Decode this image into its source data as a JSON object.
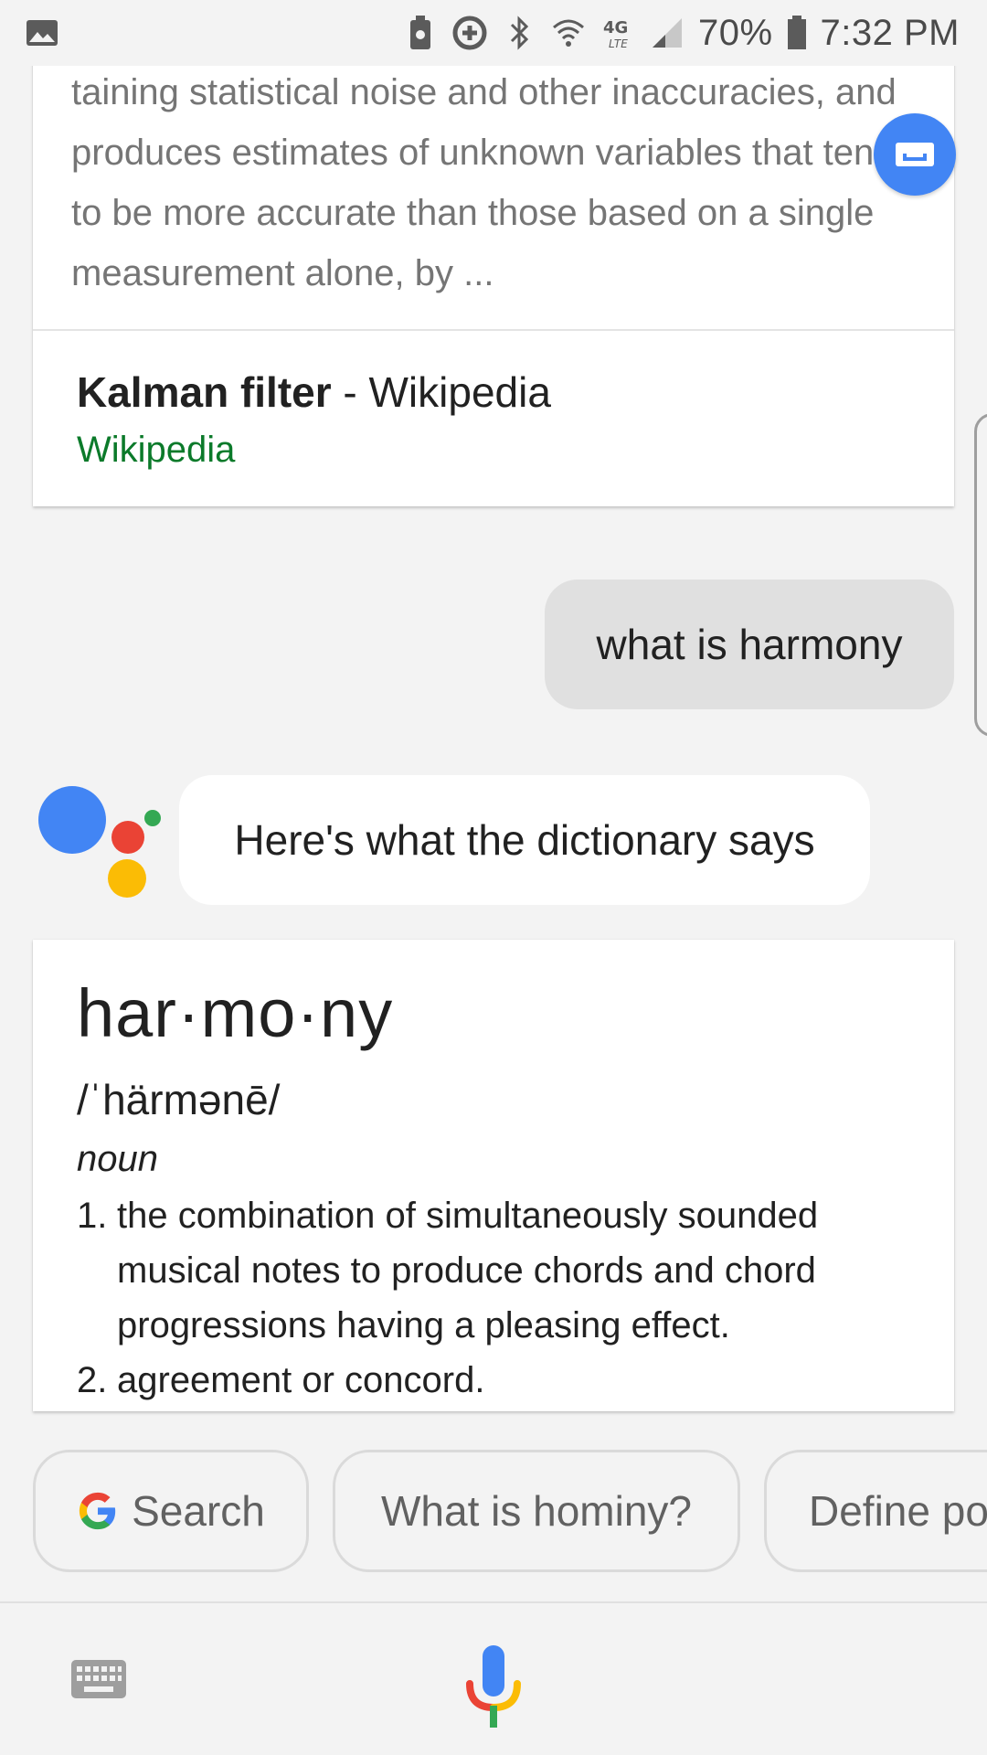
{
  "status_bar": {
    "battery": "70%",
    "time": "7:32 PM",
    "network": "4G LTE",
    "icons": [
      "gallery-icon",
      "clean-icon",
      "data-saver-icon",
      "bluetooth-icon",
      "wifi-icon",
      "signal-icon",
      "battery-icon"
    ]
  },
  "web_result": {
    "snippet": "taining statistical noise and other inaccuracies, and produces estimates of unknown variables that tend to be more accurate than those based on a single measurement alone, by ...",
    "title_bold": "Kalman filter",
    "title_rest": " - Wikipedia",
    "source": "Wikipedia",
    "source_color": "#0b7a2a"
  },
  "conversation": {
    "user_query": "what is harmony",
    "assistant_reply": "Here's what the dictionary says"
  },
  "dictionary": {
    "word": "har·mo·ny",
    "phonetic": "/ˈhärmənē/",
    "part_of_speech": "noun",
    "definitions": [
      {
        "num": "1.",
        "text": "the combination of simultaneously sounded musical notes to produce chords and chord progressions having a pleasing effect."
      },
      {
        "num": "2.",
        "text": "agreement or concord."
      }
    ]
  },
  "suggestions": [
    {
      "label": "Search"
    },
    {
      "label": "What is hominy?"
    },
    {
      "label": "Define po"
    }
  ],
  "colors": {
    "google_blue": "#4285f4",
    "google_red": "#ea4335",
    "google_yellow": "#fbbc05",
    "google_green": "#34a853"
  }
}
